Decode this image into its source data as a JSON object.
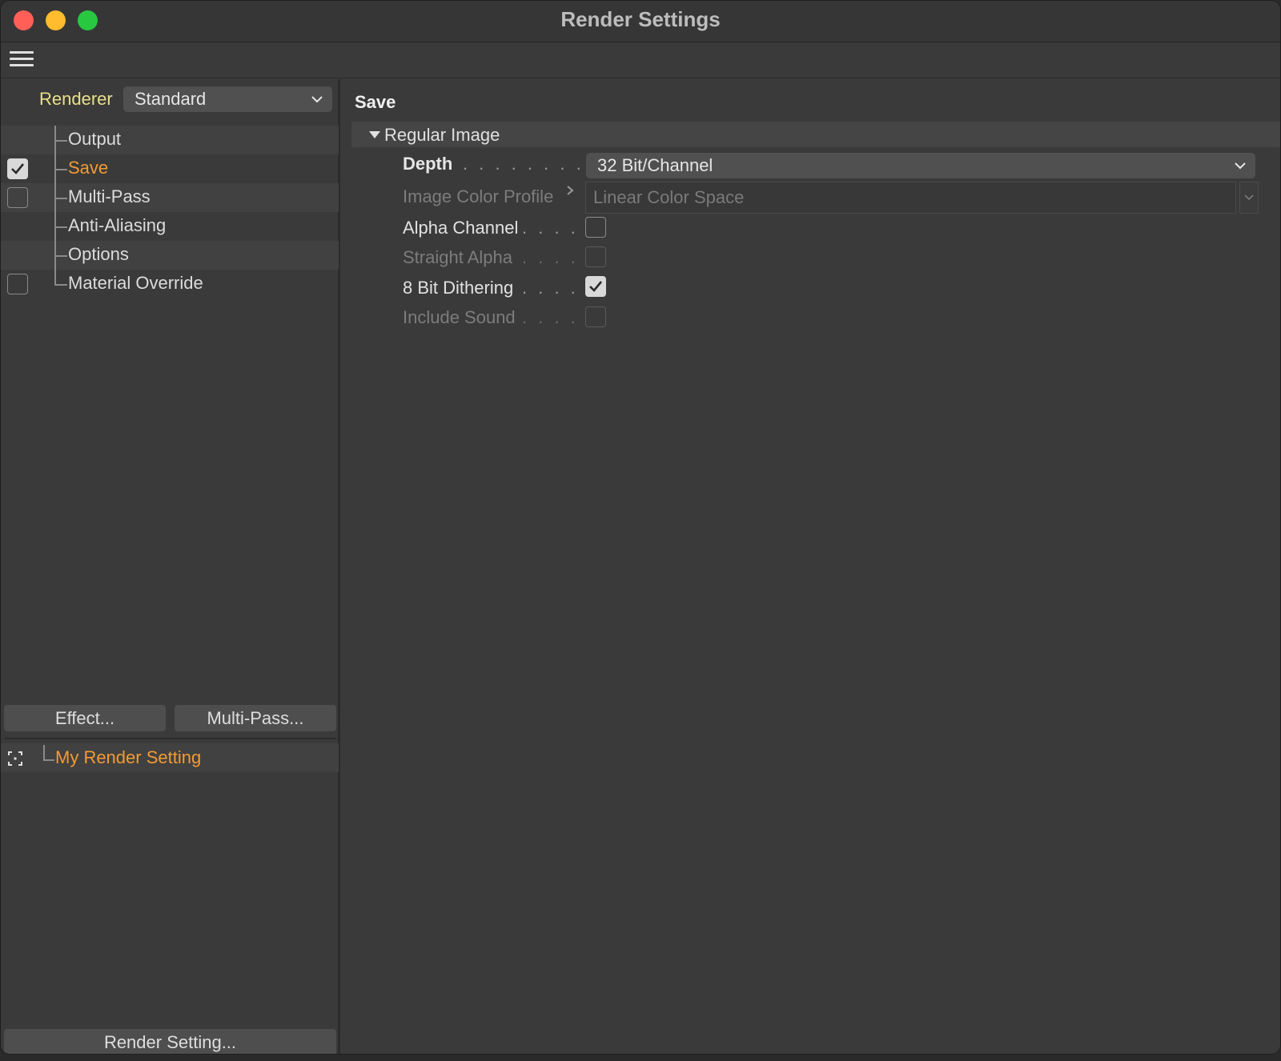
{
  "window": {
    "title": "Render Settings"
  },
  "left_panel": {
    "renderer_label": "Renderer",
    "renderer_value": "Standard",
    "tree": [
      {
        "label": "Output",
        "has_checkbox": false,
        "checked": false,
        "active": false
      },
      {
        "label": "Save",
        "has_checkbox": true,
        "checked": true,
        "active": true
      },
      {
        "label": "Multi-Pass",
        "has_checkbox": true,
        "checked": false,
        "active": false
      },
      {
        "label": "Anti-Aliasing",
        "has_checkbox": false,
        "checked": false,
        "active": false
      },
      {
        "label": "Options",
        "has_checkbox": false,
        "checked": false,
        "active": false
      },
      {
        "label": "Material Override",
        "has_checkbox": true,
        "checked": false,
        "active": false
      }
    ],
    "effect_button": "Effect...",
    "multipass_button": "Multi-Pass...",
    "render_setting_name": "My Render Setting",
    "render_setting_button": "Render Setting..."
  },
  "right_panel": {
    "section_title": "Save",
    "group_label": "Regular Image",
    "depth_label": "Depth",
    "depth_value": "32 Bit/Channel",
    "profile_label": "Image Color Profile",
    "profile_value": "Linear Color Space",
    "alpha_channel_label": "Alpha Channel",
    "alpha_channel_checked": false,
    "straight_alpha_label": "Straight Alpha",
    "straight_alpha_checked": false,
    "dithering_label": "8 Bit Dithering",
    "dithering_checked": true,
    "include_sound_label": "Include Sound",
    "include_sound_checked": false
  },
  "colors": {
    "accent_orange": "#f29b33",
    "renderer_label_yellow": "#e8e08a",
    "window_bg": "#3a3a3a"
  }
}
